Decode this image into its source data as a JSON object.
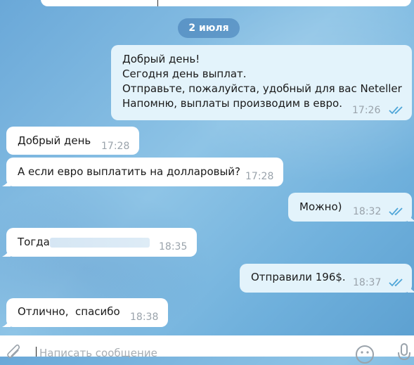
{
  "date_divider": "2 июля",
  "messages": [
    {
      "direction": "out",
      "lines": [
        "Добрый день!",
        "Сегодня день выплат.",
        "Отправьте, пожалуйста, удобный для вас Neteller",
        "Напомню, выплаты производим в евро."
      ],
      "time": "17:26",
      "read": true
    },
    {
      "direction": "in",
      "text": "Добрый день",
      "time": "17:28"
    },
    {
      "direction": "in",
      "text": "А если евро выплатить на долларовый?",
      "time": "17:28"
    },
    {
      "direction": "out",
      "text": "Можно)",
      "time": "18:32",
      "read": true
    },
    {
      "direction": "in",
      "text": "Тогда",
      "time": "18:35",
      "has_redaction": true
    },
    {
      "direction": "out",
      "text": "Отправили 196$.",
      "time": "18:37",
      "read": true
    },
    {
      "direction": "in",
      "text": "Отлично,  спасибо",
      "time": "18:38"
    }
  ],
  "composer": {
    "placeholder": "Написать сообщение",
    "attach_icon": "paperclip-icon",
    "emoji_icon": "emoji-icon",
    "mic_icon": "microphone-icon"
  },
  "colors": {
    "incoming_bubble": "#ffffff",
    "outgoing_bubble": "#e3f3fb",
    "date_pill": "#3e78b2",
    "read_ticks": "#4fa6d8"
  }
}
